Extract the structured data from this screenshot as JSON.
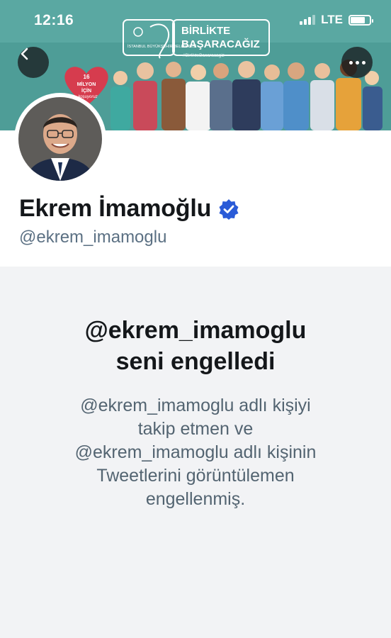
{
  "status_bar": {
    "time": "12:16",
    "network": "LTE"
  },
  "banner": {
    "slogan_line1": "BİRLİKTE",
    "slogan_line2": "BAŞARACAĞIZ",
    "hashtag": "#BirlikteBasaracagiz",
    "badge_line1": "16",
    "badge_line2": "MİLYON",
    "badge_line3": "İÇİN",
    "badge_line4": "koşuyoruz",
    "logo_text": "İSTANBUL BÜYÜKŞEHİR BELEDİYESİ"
  },
  "profile": {
    "name": "Ekrem İmamoğlu",
    "handle": "@ekrem_imamoglu",
    "verified": true
  },
  "blocked": {
    "title_line1": "@ekrem_imamoglu",
    "title_line2": "seni engelledi",
    "desc_line1": "@ekrem_imamoglu adlı kişiyi",
    "desc_line2": "takip etmen ve",
    "desc_line3": "@ekrem_imamoglu adlı kişinin",
    "desc_line4": "Tweetlerini görüntülemen",
    "desc_line5": "engellenmiş."
  },
  "colors": {
    "banner_bg": "#4e9d97",
    "verified_blue": "#1d9bf0",
    "text_primary": "#14171a",
    "text_secondary": "#536471",
    "blocked_bg": "#f2f3f5"
  }
}
